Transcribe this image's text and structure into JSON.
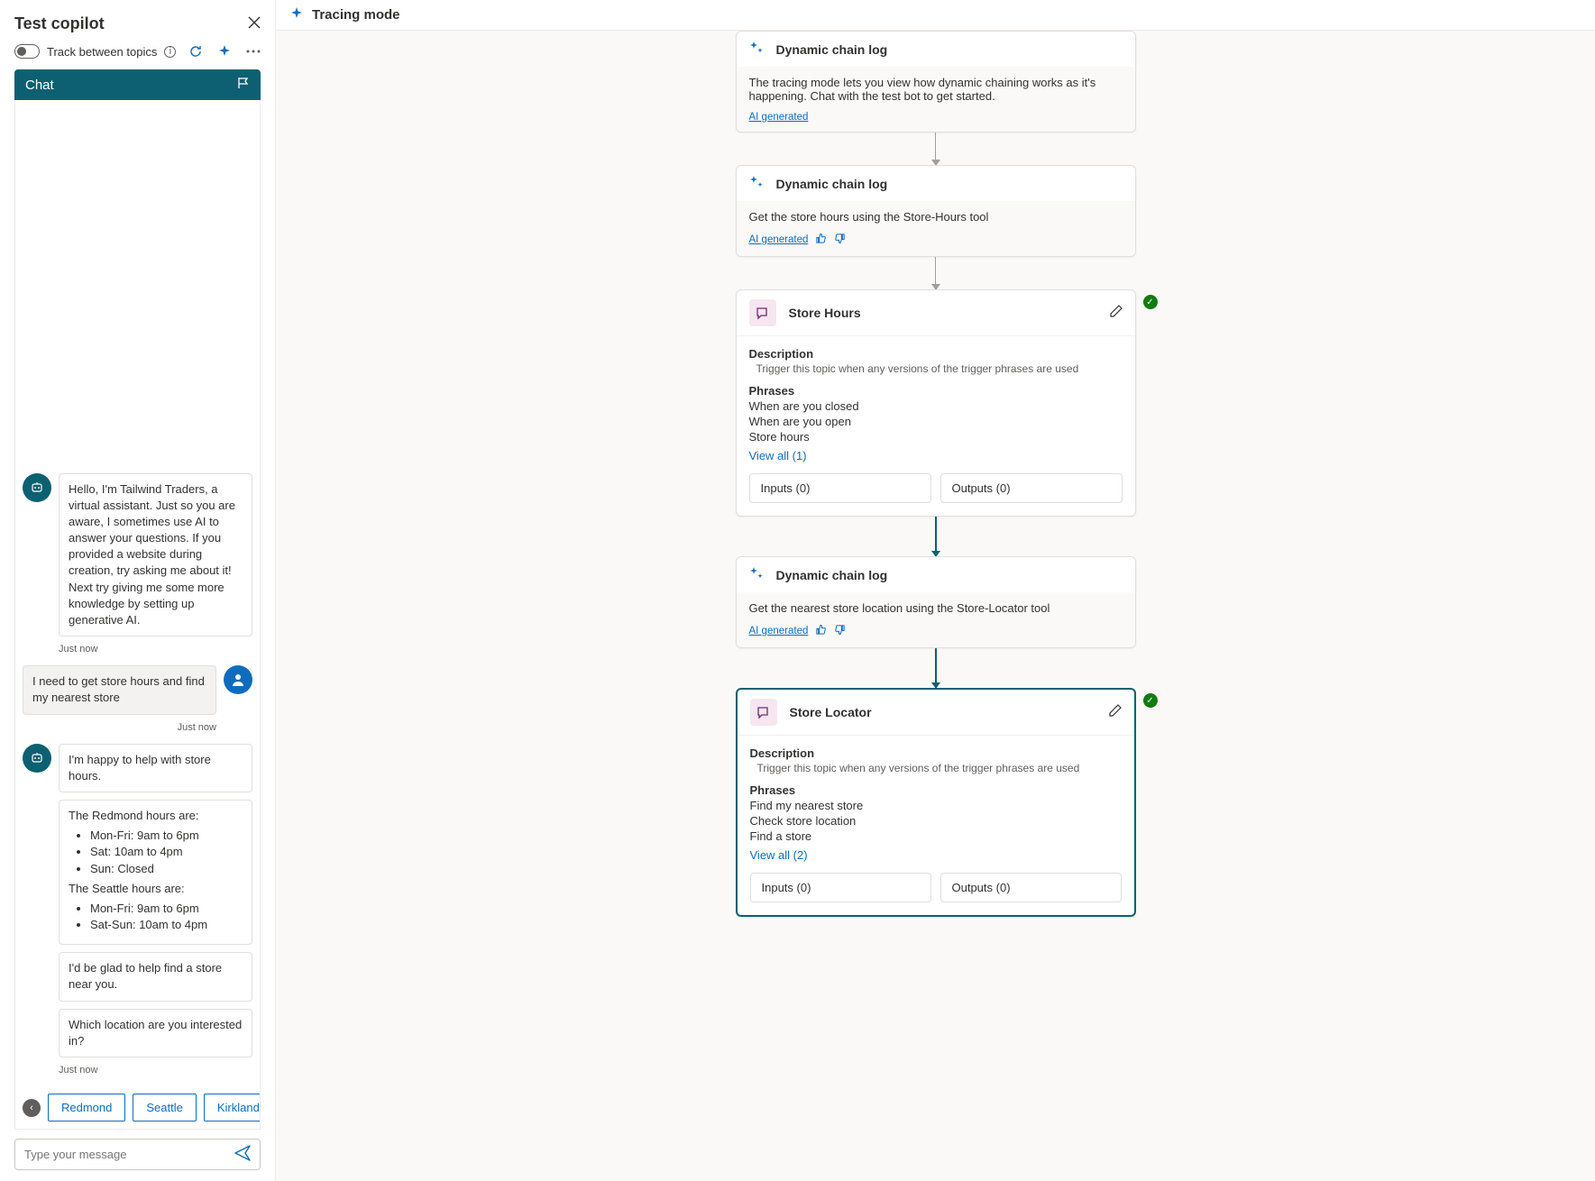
{
  "left": {
    "title": "Test copilot",
    "track_label": "Track between topics",
    "chat_tab": "Chat",
    "messages": {
      "bot_intro": "Hello, I'm Tailwind Traders, a virtual assistant. Just so you are aware, I sometimes use AI to answer your questions. If you provided a website during creation, try asking me about it! Next try giving me some more knowledge by setting up generative AI.",
      "ts1": "Just now",
      "user1": "I need to get store hours and find my nearest store",
      "ts2": "Just now",
      "bot2": "I'm happy to help with store hours.",
      "hours_redmond_label": "The Redmond hours are:",
      "hours_redmond": [
        "Mon-Fri: 9am to 6pm",
        "Sat: 10am to 4pm",
        "Sun: Closed"
      ],
      "hours_seattle_label": "The Seattle hours are:",
      "hours_seattle": [
        "Mon-Fri: 9am to 6pm",
        "Sat-Sun: 10am to 4pm"
      ],
      "bot3": "I'd be glad to help find a store near you.",
      "bot4": "Which location are you interested in?",
      "ts3": "Just now"
    },
    "suggestions": [
      "Redmond",
      "Seattle",
      "Kirkland"
    ],
    "input_placeholder": "Type your message"
  },
  "right": {
    "title": "Tracing mode",
    "ai_generated": "AI generated",
    "log1": {
      "title": "Dynamic chain log",
      "body": "The tracing mode lets you view how dynamic chaining works as it's happening. Chat with the test bot to get started."
    },
    "log2": {
      "title": "Dynamic chain log",
      "body": "Get the store hours using the Store-Hours tool"
    },
    "topic1": {
      "title": "Store Hours",
      "desc_label": "Description",
      "desc": "Trigger this topic when any versions of the trigger phrases are used",
      "phrases_label": "Phrases",
      "phrases": [
        "When are you closed",
        "When are you open",
        "Store hours"
      ],
      "view_all": "View all (1)",
      "inputs": "Inputs (0)",
      "outputs": "Outputs (0)"
    },
    "log3": {
      "title": "Dynamic chain log",
      "body": "Get the nearest store location using the Store-Locator tool"
    },
    "topic2": {
      "title": "Store Locator",
      "desc_label": "Description",
      "desc": "Trigger this topic when any versions of the trigger phrases are used",
      "phrases_label": "Phrases",
      "phrases": [
        "Find my nearest store",
        "Check store location",
        "Find a store"
      ],
      "view_all": "View all (2)",
      "inputs": "Inputs (0)",
      "outputs": "Outputs (0)"
    }
  }
}
